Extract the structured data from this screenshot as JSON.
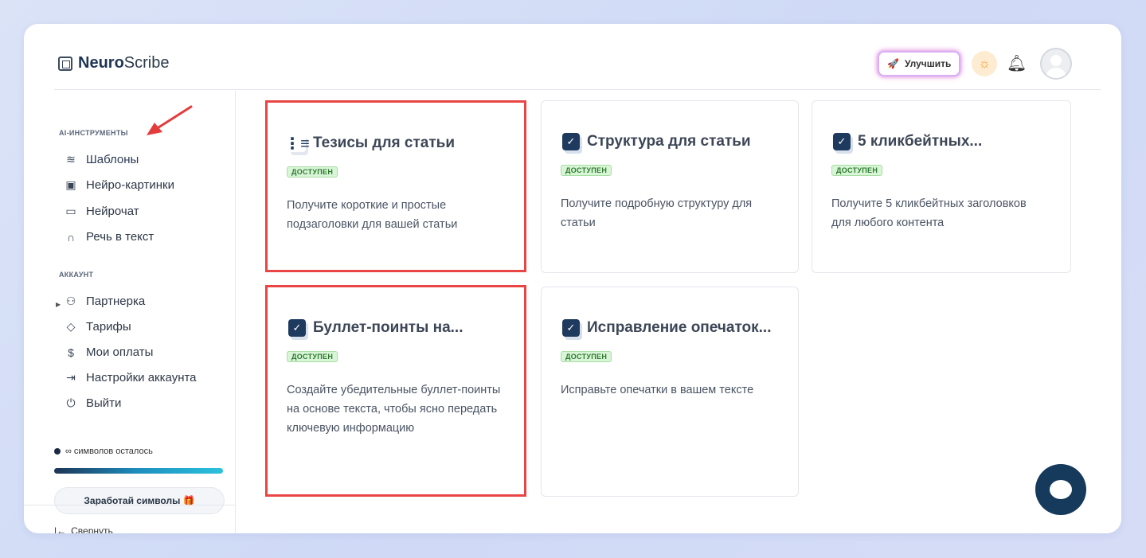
{
  "app": {
    "brand_bold": "Neuro",
    "brand_rest": "Scribe"
  },
  "header": {
    "upgrade_label": "Улучшить"
  },
  "sidebar": {
    "section_ai": "AI-ИНСТРУМЕНТЫ",
    "ai_items": [
      {
        "label": "Шаблоны",
        "icon": "layers-icon"
      },
      {
        "label": "Нейро-картинки",
        "icon": "image-icon"
      },
      {
        "label": "Нейрочат",
        "icon": "chat-icon"
      },
      {
        "label": "Речь в текст",
        "icon": "headphones-icon"
      }
    ],
    "section_account": "АККАУНТ",
    "account_items": [
      {
        "label": "Партнерка",
        "icon": "users-icon"
      },
      {
        "label": "Тарифы",
        "icon": "tag-icon"
      },
      {
        "label": "Мои оплаты",
        "icon": "dollar-icon"
      },
      {
        "label": "Настройки аккаунта",
        "icon": "login-icon"
      },
      {
        "label": "Выйти",
        "icon": "power-icon"
      }
    ],
    "symbols_left": "∞ символов осталось",
    "earn_button": "Заработай символы 🎁",
    "collapse_label": "Свернуть"
  },
  "cards": [
    {
      "title": "Тезисы для статьи",
      "badge": "ДОСТУПЕН",
      "desc": "Получите короткие и простые подзаголовки для вашей статьи",
      "icon": "list-ordered-icon",
      "highlighted": true
    },
    {
      "title": "Структура для статьи",
      "badge": "ДОСТУПЕН",
      "desc": "Получите подробную структуру для статьи",
      "icon": "checkbox-icon",
      "highlighted": false
    },
    {
      "title": "5 кликбейтных...",
      "badge": "ДОСТУПЕН",
      "desc": "Получите 5 кликбейтных заголовков для любого контента",
      "icon": "checkbox-icon",
      "highlighted": false
    },
    {
      "title": "Буллет-поинты на...",
      "badge": "ДОСТУПЕН",
      "desc": "Создайте убедительные буллет-поинты на основе текста, чтобы ясно передать ключевую информацию",
      "icon": "checkbox-icon",
      "highlighted": true
    },
    {
      "title": "Исправление опечаток...",
      "badge": "ДОСТУПЕН",
      "desc": "Исправьте опечатки в вашем тексте",
      "icon": "checkbox-icon",
      "highlighted": false
    }
  ]
}
